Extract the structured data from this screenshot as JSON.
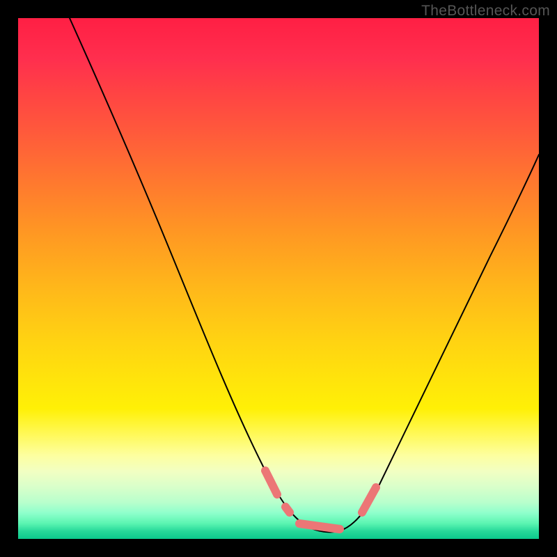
{
  "watermark": "TheBottleneck.com",
  "chart_data": {
    "type": "line",
    "title": "",
    "xlabel": "",
    "ylabel": "",
    "xlim": [
      0,
      100
    ],
    "ylim": [
      0,
      100
    ],
    "grid": false,
    "legend": false,
    "background_gradient": {
      "direction": "top-to-bottom",
      "stops": [
        {
          "pct": 0,
          "color": "#ff1f44"
        },
        {
          "pct": 25,
          "color": "#ff6a33"
        },
        {
          "pct": 50,
          "color": "#ffbc18"
        },
        {
          "pct": 75,
          "color": "#fff006"
        },
        {
          "pct": 90,
          "color": "#d9ffca"
        },
        {
          "pct": 100,
          "color": "#0bc98c"
        }
      ]
    },
    "series": [
      {
        "name": "bottleneck-curve",
        "stroke": "#000000",
        "x": [
          10,
          14,
          18,
          22,
          26,
          30,
          34,
          38,
          42,
          46,
          49,
          51.5,
          53,
          55,
          57,
          59,
          61,
          63,
          65,
          68,
          72,
          76,
          80,
          84,
          88,
          92,
          96,
          100
        ],
        "y": [
          100,
          92,
          83,
          74,
          65,
          56,
          47,
          38,
          29,
          20,
          13,
          8,
          5,
          3,
          2,
          2,
          2,
          3,
          5,
          8,
          14,
          21,
          29,
          37,
          45,
          53,
          61,
          69
        ]
      },
      {
        "name": "highlight-segments",
        "stroke": "#ec7676",
        "type": "scatter",
        "points": [
          {
            "x": 48,
            "y": 13
          },
          {
            "x": 50,
            "y": 9
          },
          {
            "x": 52.5,
            "y": 6
          },
          {
            "x": 56,
            "y": 2.5
          },
          {
            "x": 59,
            "y": 2
          },
          {
            "x": 62,
            "y": 2.5
          },
          {
            "x": 66,
            "y": 6.5
          },
          {
            "x": 68,
            "y": 9
          }
        ]
      }
    ]
  }
}
